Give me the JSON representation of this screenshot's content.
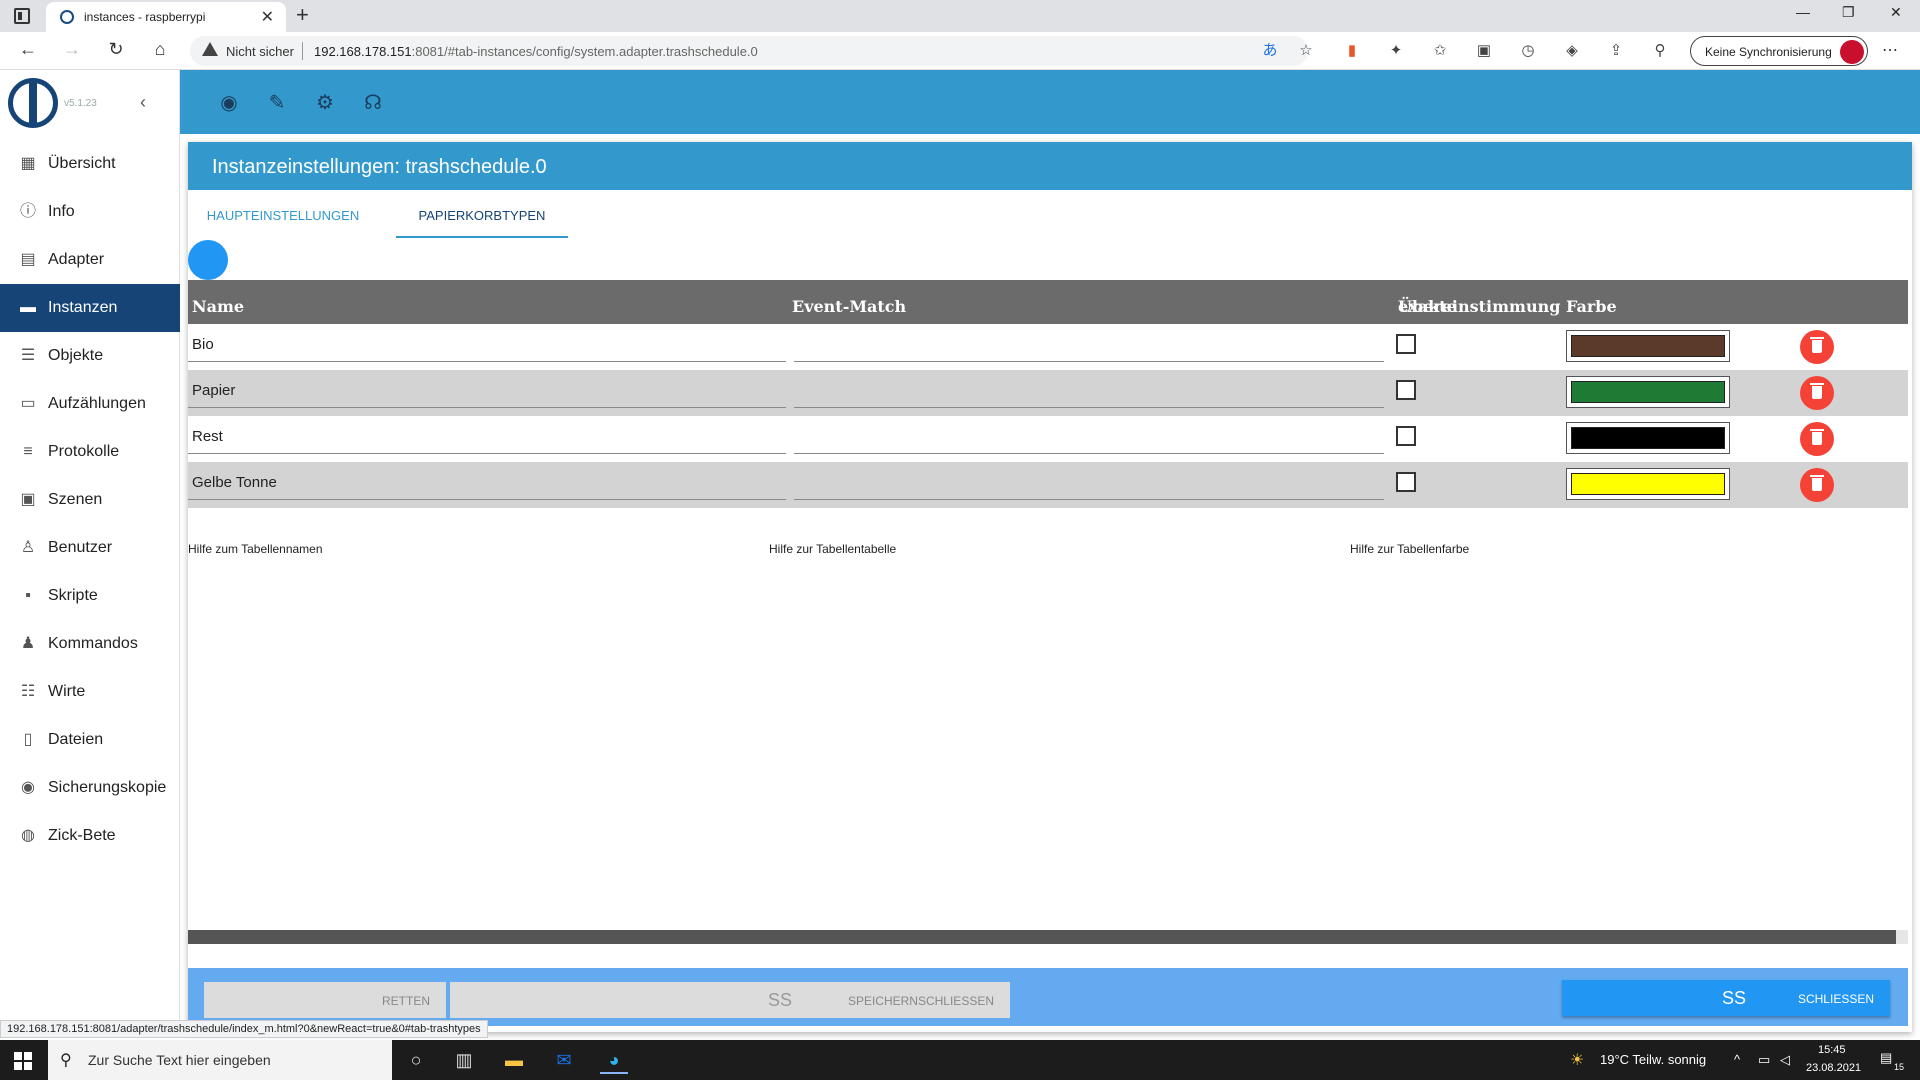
{
  "browser": {
    "tab_title": "instances - raspberrypi",
    "new_tab": "+",
    "tab_close": "✕",
    "security_warning": "Nicht sicher",
    "url_host": "192.168.178.151",
    "url_rest": ":8081/#tab-instances/config/system.adapter.trashschedule.0",
    "sync_label": "Keine Synchronisierung",
    "status_url": "192.168.178.151:8081/adapter/trashschedule/index_m.html?0&newReact=true&0#tab-trashtypes",
    "window_controls": [
      "—",
      "❐",
      "✕"
    ]
  },
  "app": {
    "version": "v5.1.23",
    "collapse_glyph": "‹",
    "top_icons": [
      "eye-icon",
      "wrench-icon",
      "gear-icon",
      "brain-icon"
    ],
    "sidebar": {
      "items": [
        {
          "label": "Übersicht",
          "icon": "▦"
        },
        {
          "label": "Info",
          "icon": "ⓘ"
        },
        {
          "label": "Adapter",
          "icon": "▤"
        },
        {
          "label": "Instanzen",
          "icon": "▬",
          "active": true
        },
        {
          "label": "Objekte",
          "icon": "☰"
        },
        {
          "label": "Aufzählungen",
          "icon": "▭"
        },
        {
          "label": "Protokolle",
          "icon": "≡"
        },
        {
          "label": "Szenen",
          "icon": "▣"
        },
        {
          "label": "Benutzer",
          "icon": "♙"
        },
        {
          "label": "Skripte",
          "icon": "▪"
        },
        {
          "label": "Kommandos",
          "icon": "♟"
        },
        {
          "label": "Wirte",
          "icon": "☷"
        },
        {
          "label": "Dateien",
          "icon": "▯"
        },
        {
          "label": "Sicherungskopie",
          "icon": "◉"
        },
        {
          "label": "Zick-Bete",
          "icon": "◍"
        }
      ]
    }
  },
  "dialog": {
    "title": "Instanzeinstellungen: trashschedule.0",
    "tabs": [
      "HAUPTEINSTELLUNGEN",
      "PAPIERKORBTYPEN"
    ],
    "active_tab": 1,
    "table": {
      "headers": {
        "name": "Name",
        "match": "Event-Match",
        "exact_line1": "exakte",
        "exact_line2": "Übereinstimmung",
        "color": "Farbe"
      },
      "rows": [
        {
          "name": "Bio",
          "match": "",
          "exact": false,
          "color": "#5b3a29"
        },
        {
          "name": "Papier",
          "match": "",
          "exact": false,
          "color": "#1e7b34"
        },
        {
          "name": "Rest",
          "match": "",
          "exact": false,
          "color": "#000000"
        },
        {
          "name": "Gelbe Tonne",
          "match": "",
          "exact": false,
          "color": "#ffff00"
        }
      ]
    },
    "help": {
      "name": "Hilfe zum Tabellennamen",
      "table": "Hilfe zur Tabellentabelle",
      "color": "Hilfe zur Tabellenfarbe"
    },
    "buttons": {
      "save": "RETTEN",
      "save_close": "SPEICHERNSCHLIESSEN",
      "close": "SCHLIESSEN",
      "glyph": "ß"
    }
  },
  "taskbar": {
    "search_placeholder": "Zur Suche Text hier eingeben",
    "weather": "19°C  Teilw. sonnig",
    "time": "15:45",
    "date": "23.08.2021",
    "notifications": "15"
  }
}
